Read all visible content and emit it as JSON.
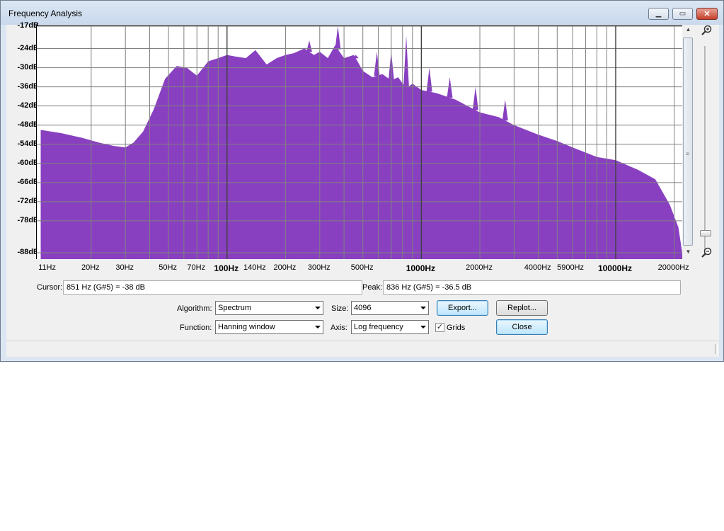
{
  "window": {
    "title": "Frequency Analysis"
  },
  "chart_data": {
    "type": "area",
    "xscale": "log",
    "ylim": [
      -90,
      -17
    ],
    "y_ticks": [
      "-17dB",
      "-24dB",
      "-30dB",
      "-36dB",
      "-42dB",
      "-48dB",
      "-54dB",
      "-60dB",
      "-66dB",
      "-72dB",
      "-78dB",
      "-88dB"
    ],
    "y_tick_values": [
      -17,
      -24,
      -30,
      -36,
      -42,
      -48,
      -54,
      -60,
      -66,
      -72,
      -78,
      -88
    ],
    "x_ticks": [
      "11Hz",
      "20Hz",
      "30Hz",
      "50Hz",
      "70Hz",
      "100Hz",
      "140Hz",
      "200Hz",
      "300Hz",
      "500Hz",
      "1000Hz",
      "2000Hz",
      "4000Hz",
      "5900Hz",
      "10000Hz",
      "20000Hz"
    ],
    "x_tick_values": [
      11,
      20,
      30,
      50,
      70,
      100,
      140,
      200,
      300,
      500,
      1000,
      2000,
      4000,
      5900,
      10000,
      20000
    ],
    "x_tick_bold": [
      "100Hz",
      "1000Hz",
      "10000Hz"
    ],
    "xlim": [
      10.5,
      22000
    ],
    "fill_color": "#8840c0",
    "grid": true,
    "x": [
      11,
      14,
      18,
      22,
      26,
      30,
      33,
      37,
      42,
      48,
      55,
      62,
      70,
      80,
      90,
      100,
      110,
      125,
      140,
      160,
      180,
      200,
      220,
      250,
      280,
      300,
      330,
      360,
      400,
      450,
      500,
      560,
      630,
      700,
      760,
      836,
      900,
      1000,
      1200,
      1500,
      2000,
      2500,
      3000,
      4000,
      5000,
      6000,
      8000,
      10000,
      13000,
      16000,
      19000,
      21000,
      22000
    ],
    "y": [
      -49.5,
      -50.5,
      -52,
      -53.5,
      -54.5,
      -55,
      -53.5,
      -50,
      -43,
      -33.5,
      -29.5,
      -30,
      -32.5,
      -28,
      -27,
      -26,
      -26.5,
      -27,
      -24.5,
      -29,
      -27,
      -26,
      -25.5,
      -24,
      -26,
      -25,
      -27,
      -23,
      -27,
      -26,
      -31,
      -33,
      -32,
      -34,
      -33,
      -36.5,
      -35,
      -37,
      -38,
      -40,
      -44,
      -45.5,
      -48,
      -51,
      -53,
      -55,
      -58,
      -59,
      -62,
      -65,
      -73,
      -80,
      -88
    ],
    "spikes": [
      {
        "x": 265,
        "y": -21.5
      },
      {
        "x": 372,
        "y": -17
      },
      {
        "x": 836,
        "y": -20
      },
      {
        "x": 590,
        "y": -25
      },
      {
        "x": 700,
        "y": -25
      },
      {
        "x": 460,
        "y": -26
      },
      {
        "x": 1100,
        "y": -30
      },
      {
        "x": 1400,
        "y": -33
      },
      {
        "x": 1900,
        "y": -36
      },
      {
        "x": 2700,
        "y": -40
      }
    ]
  },
  "cursor": {
    "label": "Cursor:",
    "value": "851 Hz (G#5) = -38 dB"
  },
  "peak": {
    "label": "Peak:",
    "value": "836 Hz (G#5) = -36.5 dB"
  },
  "controls": {
    "algorithm_label": "Algorithm:",
    "algorithm_value": "Spectrum",
    "size_label": "Size:",
    "size_value": "4096",
    "function_label": "Function:",
    "function_value": "Hanning window",
    "axis_label": "Axis:",
    "axis_value": "Log frequency",
    "grids_label": "Grids",
    "grids_checked": true,
    "export_label": "Export...",
    "replot_label": "Replot...",
    "close_label": "Close"
  }
}
